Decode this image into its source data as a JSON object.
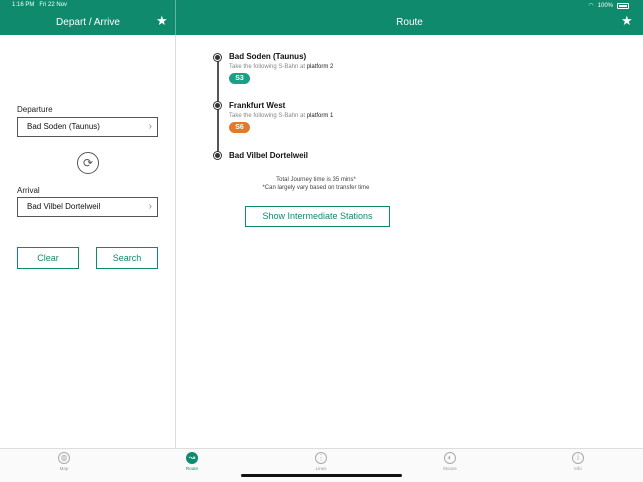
{
  "status": {
    "time": "1:16 PM",
    "date": "Fri 22 Nov",
    "battery": "100%"
  },
  "left_panel": {
    "title": "Depart / Arrive",
    "departure_label": "Departure",
    "departure_value": "Bad Soden (Taunus)",
    "arrival_label": "Arrival",
    "arrival_value": "Bad Vilbel Dortelweil",
    "clear_label": "Clear",
    "search_label": "Search"
  },
  "route": {
    "title": "Route",
    "stops": [
      {
        "name": "Bad Soden (Taunus)",
        "instruction": "Take the following S-Bahn at",
        "platform": "platform 2",
        "line": "S3",
        "line_color": "#1aa087"
      },
      {
        "name": "Frankfurt West",
        "instruction": "Take the following S-Bahn at",
        "platform": "platform 1",
        "line": "S6",
        "line_color": "#e07a2e"
      },
      {
        "name": "Bad Vilbel Dortelweil"
      }
    ],
    "journey_time": "Total Journey time is 35 mins*",
    "disclaimer": "*Can largely vary based on transfer time",
    "show_stations_label": "Show Intermediate Stations"
  },
  "tabs": [
    {
      "label": "Map",
      "icon": "globe-icon",
      "active": false
    },
    {
      "label": "Route",
      "icon": "route-icon",
      "active": true
    },
    {
      "label": "Lines",
      "icon": "grid-icon",
      "active": false
    },
    {
      "label": "Moove",
      "icon": "compass-icon",
      "active": false
    },
    {
      "label": "Info",
      "icon": "info-icon",
      "active": false
    }
  ],
  "colors": {
    "brand": "#0f8a6c"
  }
}
